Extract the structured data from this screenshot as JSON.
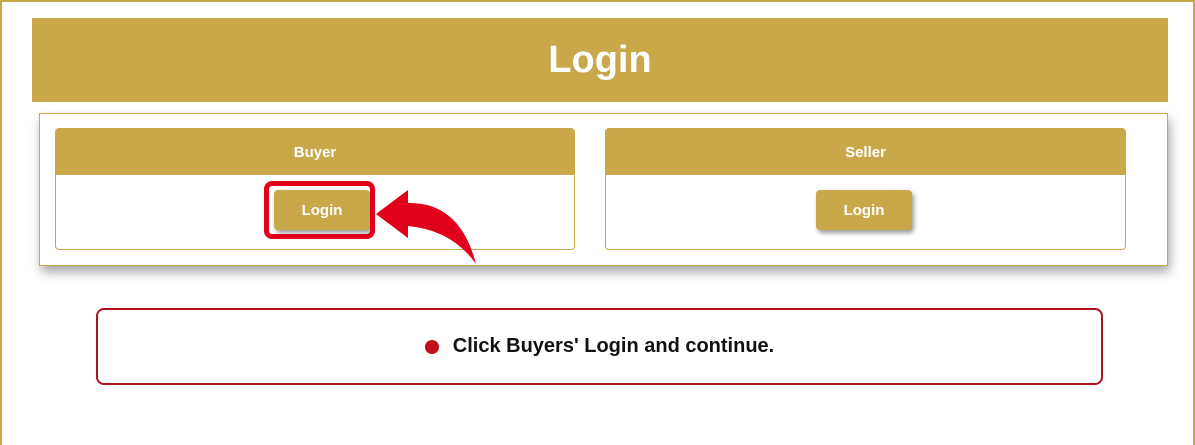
{
  "page": {
    "title": "Login"
  },
  "buyer": {
    "header": "Buyer",
    "login_label": "Login"
  },
  "seller": {
    "header": "Seller",
    "login_label": "Login"
  },
  "instruction": {
    "text": "Click Buyers' Login and continue."
  },
  "colors": {
    "gold": "#c9a84a",
    "highlight_red": "#e0001b",
    "instruction_border": "#b0111f"
  },
  "icons": {
    "pointer": "curved-arrow-icon",
    "bullet": "bullet-dot-icon"
  }
}
